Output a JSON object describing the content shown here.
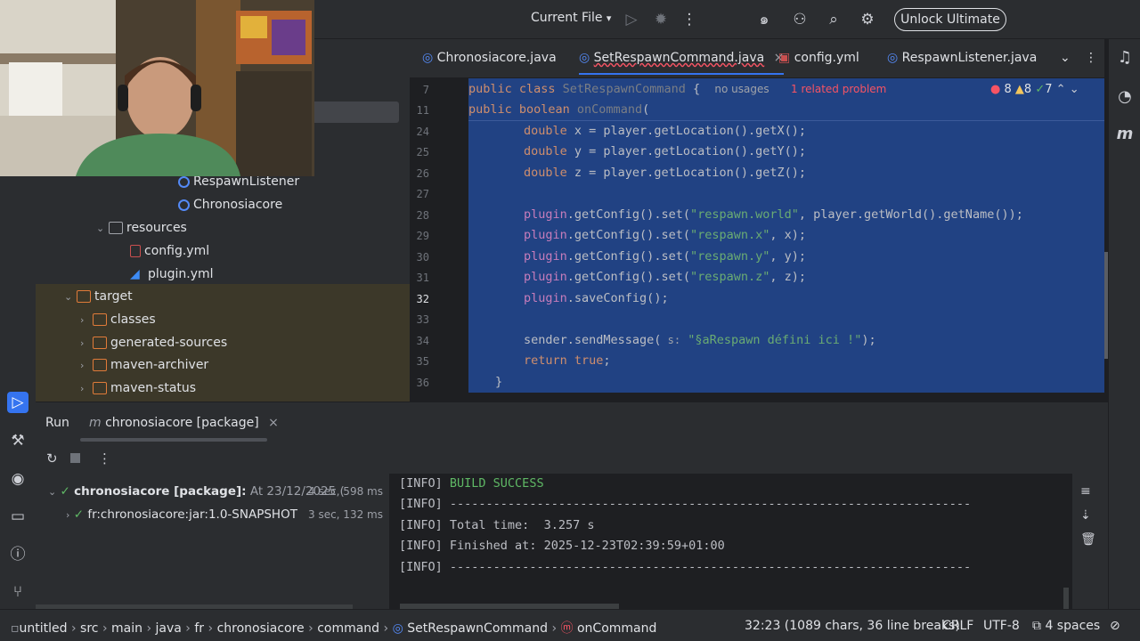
{
  "topbar": {
    "run_config": "Current File",
    "unlock_label": "Unlock Ultimate"
  },
  "project_tree": [
    {
      "label": "RespawnListener",
      "icon": "class-icon"
    },
    {
      "label": "Chronosiacore",
      "icon": "class-icon"
    },
    {
      "label": "resources",
      "icon": "folder-icon"
    },
    {
      "label": "config.yml",
      "icon": "yaml-icon"
    },
    {
      "label": "plugin.yml",
      "icon": "plugin-icon"
    },
    {
      "label": "target",
      "icon": "folder-icon"
    },
    {
      "label": "classes",
      "icon": "folder-icon"
    },
    {
      "label": "generated-sources",
      "icon": "folder-icon"
    },
    {
      "label": "maven-archiver",
      "icon": "folder-icon"
    },
    {
      "label": "maven-status",
      "icon": "folder-icon"
    }
  ],
  "tabs": [
    {
      "label": "Chronosiacore.java"
    },
    {
      "label": "SetRespawnCommand.java"
    },
    {
      "label": "config.yml"
    },
    {
      "label": "RespawnListener.java"
    }
  ],
  "sticky": {
    "line7": "7",
    "line11": "11",
    "class_decl_kw": "public class ",
    "class_name": "SetRespawnCommand",
    "brace": " {",
    "usages": "no usages",
    "problem": "1 related problem",
    "method_kw": "public boolean ",
    "method_name": "onCommand",
    "paren": "(",
    "errors": "8",
    "warnings": "8",
    "ok": "7"
  },
  "code_lines": {
    "l24": "24",
    "l25": "25",
    "l26": "26",
    "l27": "27",
    "l28": "28",
    "l29": "29",
    "l30": "30",
    "l31": "31",
    "l32": "32",
    "l33": "33",
    "l34": "34",
    "l35": "35",
    "l36": "36",
    "double_kw": "double",
    "x_decl": " x = player.getLocation().getX();",
    "y_decl": " y = player.getLocation().getY();",
    "z_decl": " z = player.getLocation().getZ();",
    "plugin": "plugin",
    "set_world_a": ".getConfig().set(",
    "world_str": "\"respawn.world\"",
    "set_world_b": ", player.getWorld().getName());",
    "x_str": "\"respawn.x\"",
    "x_end": ", x);",
    "y_str": "\"respawn.y\"",
    "y_end": ", y);",
    "z_str": "\"respawn.z\"",
    "z_end": ", z);",
    "save": ".saveConfig();",
    "send_a": "sender.sendMessage(",
    "hint_s": " s:",
    "msg_str": " \"§aRespawn défini ici !\"",
    "send_b": ");",
    "return_kw": "return ",
    "true_kw": "true",
    "semi": ";",
    "close_brace": "}"
  },
  "run_panel": {
    "tab_run": "Run",
    "tab_config": "chronosiacore [package]",
    "root_label": "chronosiacore [package]:",
    "root_date": "At 23/12/2025 (",
    "root_time": "4 sec, 598 ms",
    "child_label": "fr:chronosiacore:jar:1.0-SNAPSHOT",
    "child_time": "3 sec, 132 ms",
    "console": [
      {
        "tag": "[INFO]",
        "text": " BUILD SUCCESS"
      },
      {
        "tag": "[INFO]",
        "text": " ------------------------------------------------------------------------"
      },
      {
        "tag": "[INFO]",
        "text": " Total time:  3.257 s"
      },
      {
        "tag": "[INFO]",
        "text": " Finished at: 2025-12-23T02:39:59+01:00"
      },
      {
        "tag": "[INFO]",
        "text": " ------------------------------------------------------------------------"
      }
    ]
  },
  "statusbar": {
    "project": "untitled",
    "path": [
      "src",
      "main",
      "java",
      "fr",
      "chronosiacore",
      "command"
    ],
    "class_name": "SetRespawnCommand",
    "method_name": "onCommand",
    "position": "32:23 (1089 chars, 36 line breaks)",
    "line_sep": "CRLF",
    "encoding": "UTF-8",
    "indent": "4 spaces"
  },
  "colors": {
    "accent": "#3574f0",
    "selection": "#214283",
    "success": "#5fb865",
    "error": "#f75464",
    "warning": "#f2c55c"
  }
}
